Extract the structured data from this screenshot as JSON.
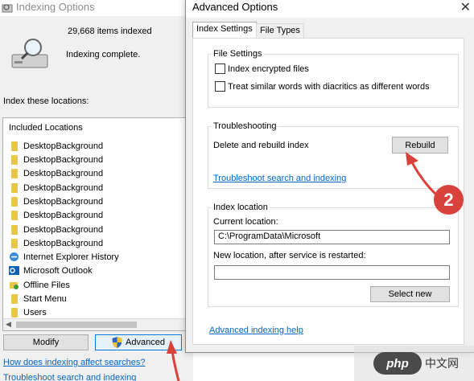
{
  "indexing_window": {
    "title": "Indexing Options",
    "items_count": "29,668 items indexed",
    "status": "Indexing complete.",
    "locations_label": "Index these locations:",
    "list_header": "Included Locations",
    "locations": [
      {
        "label": "DesktopBackground",
        "icon": "folder-icon"
      },
      {
        "label": "DesktopBackground",
        "icon": "folder-icon"
      },
      {
        "label": "DesktopBackground",
        "icon": "folder-icon"
      },
      {
        "label": "DesktopBackground",
        "icon": "folder-icon"
      },
      {
        "label": "DesktopBackground",
        "icon": "folder-icon"
      },
      {
        "label": "DesktopBackground",
        "icon": "folder-icon"
      },
      {
        "label": "DesktopBackground",
        "icon": "folder-icon"
      },
      {
        "label": "DesktopBackground",
        "icon": "folder-icon"
      },
      {
        "label": "Internet Explorer History",
        "icon": "internet-explorer-icon"
      },
      {
        "label": "Microsoft Outlook",
        "icon": "outlook-icon"
      },
      {
        "label": "Offline Files",
        "icon": "offline-files-icon"
      },
      {
        "label": "Start Menu",
        "icon": "folder-icon"
      },
      {
        "label": "Users",
        "icon": "folder-icon"
      }
    ],
    "modify_label": "Modify",
    "advanced_label": "Advanced",
    "how_link": "How does indexing affect searches?",
    "troubleshoot_link": "Troubleshoot search and indexing"
  },
  "advanced_dialog": {
    "title": "Advanced Options",
    "close_glyph": "✕",
    "tabs": [
      {
        "label": "Index Settings",
        "selected": true
      },
      {
        "label": "File Types",
        "selected": false
      }
    ],
    "file_settings": {
      "legend": "File Settings",
      "encrypt_label": "Index encrypted files",
      "encrypt_checked": false,
      "diacritics_label": "Treat similar words with diacritics as different words",
      "diacritics_checked": false
    },
    "troubleshooting": {
      "legend": "Troubleshooting",
      "delete_label": "Delete and rebuild index",
      "rebuild_label": "Rebuild",
      "link": "Troubleshoot search and indexing"
    },
    "index_location": {
      "legend": "Index location",
      "current_label": "Current location:",
      "current_value": "C:\\ProgramData\\Microsoft",
      "new_label": "New location, after service is restarted:",
      "new_value": "",
      "select_new_label": "Select new"
    },
    "help_link": "Advanced indexing help"
  },
  "annotations": {
    "step_badge": "2",
    "color": "#d9423c"
  },
  "watermark": {
    "logo": "php",
    "text": "中文网"
  }
}
